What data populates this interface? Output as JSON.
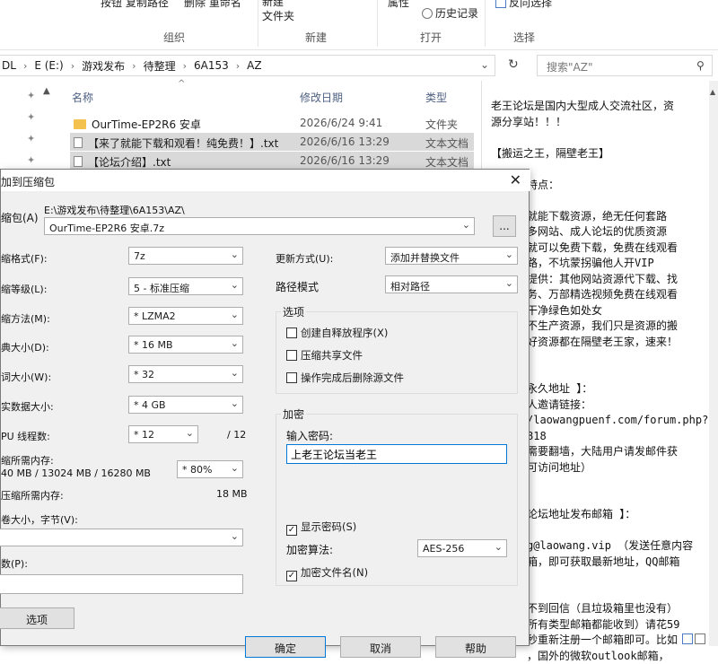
{
  "ribbon": {
    "btn1": "按钮 复制路径",
    "btn2": "删除  重命名",
    "new_folder": "新建\n文件夹",
    "properties": "属性",
    "history": "历史记录",
    "invert_sel": "反向选择",
    "groups": [
      "组织",
      "新建",
      "打开",
      "选择"
    ]
  },
  "address": {
    "crumbs": [
      "DL",
      "E (E:)",
      "游戏发布",
      "待整理",
      "6A153",
      "AZ"
    ],
    "search_placeholder": "搜索\"AZ\""
  },
  "files": {
    "col_name": "名称",
    "col_date": "修改日期",
    "col_type": "类型",
    "rows": [
      {
        "name": "OurTime-EP2R6 安卓",
        "date": "2026/6/24 9:41",
        "type": "文件夹",
        "icon": "folder-icon"
      },
      {
        "name": "【来了就能下载和观看！纯免费！】.txt",
        "date": "2026/6/16 13:29",
        "type": "文本文档",
        "icon": "text-file-icon"
      },
      {
        "name": "【论坛介绍】.txt",
        "date": "2026/6/16 13:29",
        "type": "文本文档",
        "icon": "text-file-icon"
      }
    ]
  },
  "textpane": {
    "lines": [
      "老王论坛是国内大型成人交流社区，资",
      "源分享站！！！",
      "",
      "【搬运之王，隔壁老王】",
      "",
      "特点：",
      "",
      "就能下载资源，绝无任何套路",
      "多网站、成人论坛的优质资源",
      "就可以免费下载，免费在线观看",
      "路，不坑蒙拐骗他人开VIP",
      "提供：其他网站资源代下载、找",
      "务、万部精选视频免费在线观看",
      "干净绿色如处女",
      "不生产资源，我们只是资源的搬",
      "好资源都在隔壁老王家，速来！",
      "",
      "",
      "永久地址 】：",
      "人邀请链接：",
      "/laowangpuenf.com/forum.php?",
      "818",
      "需要翻墙，大陆用户请发邮件获",
      "可访问地址）",
      "",
      "",
      "论坛地址发布邮箱 】：",
      "",
      "g@laowang.vip  （发送任意内容",
      "箱，即可获取最新地址，QQ邮箱",
      "",
      "",
      "不到回信（且垃圾箱里也没有）",
      "所有类型邮箱都能收到）请花59",
      "秒重新注册一个邮箱即可。比如",
      "，国外的微软outlook邮箱，"
    ]
  },
  "dialog": {
    "title": "加到压缩包",
    "archive_label": "缩包(A)",
    "archive_path": "E:\\游戏发布\\待整理\\6A153\\AZ\\",
    "archive_name": "OurTime-EP2R6 安卓.7z",
    "browse": "...",
    "format_label": "缩格式(F):",
    "format_value": "7z",
    "level_label": "缩等级(L):",
    "level_value": "5 - 标准压缩",
    "method_label": "缩方法(M):",
    "method_value": "* LZMA2",
    "dict_label": "典大小(D):",
    "dict_value": "* 16 MB",
    "word_label": "词大小(W):",
    "word_value": "* 32",
    "solid_label": "实数据大小:",
    "solid_value": "* 4 GB",
    "cpu_label": "PU 线程数:",
    "cpu_value": "* 12",
    "cpu_total": "/ 12",
    "mem_label": "缩所需内存:",
    "mem_value": "40 MB / 13024 MB / 16280 MB",
    "mem_pct": "* 80%",
    "decomp_label": "压缩所需内存:",
    "decomp_value": "18 MB",
    "vol_label": "卷大小，字节(V):",
    "params_label": "数(P):",
    "options_btn": "选项",
    "update_label": "更新方式(U):",
    "update_value": "添加并替换文件",
    "pathmode_label": "路径模式",
    "pathmode_value": "相对路径",
    "options_group": "选项",
    "opt1": "创建自释放程序(X)",
    "opt2": "压缩共享文件",
    "opt3": "操作完成后删除源文件",
    "enc_group": "加密",
    "pwd_label": "输入密码:",
    "pwd_value": "上老王论坛当老王",
    "show_pwd": "显示密码(S)",
    "enc_method_label": "加密算法:",
    "enc_method_value": "AES-256",
    "enc_names": "加密文件名(N)",
    "ok": "确定",
    "cancel": "取消",
    "help": "帮助"
  }
}
